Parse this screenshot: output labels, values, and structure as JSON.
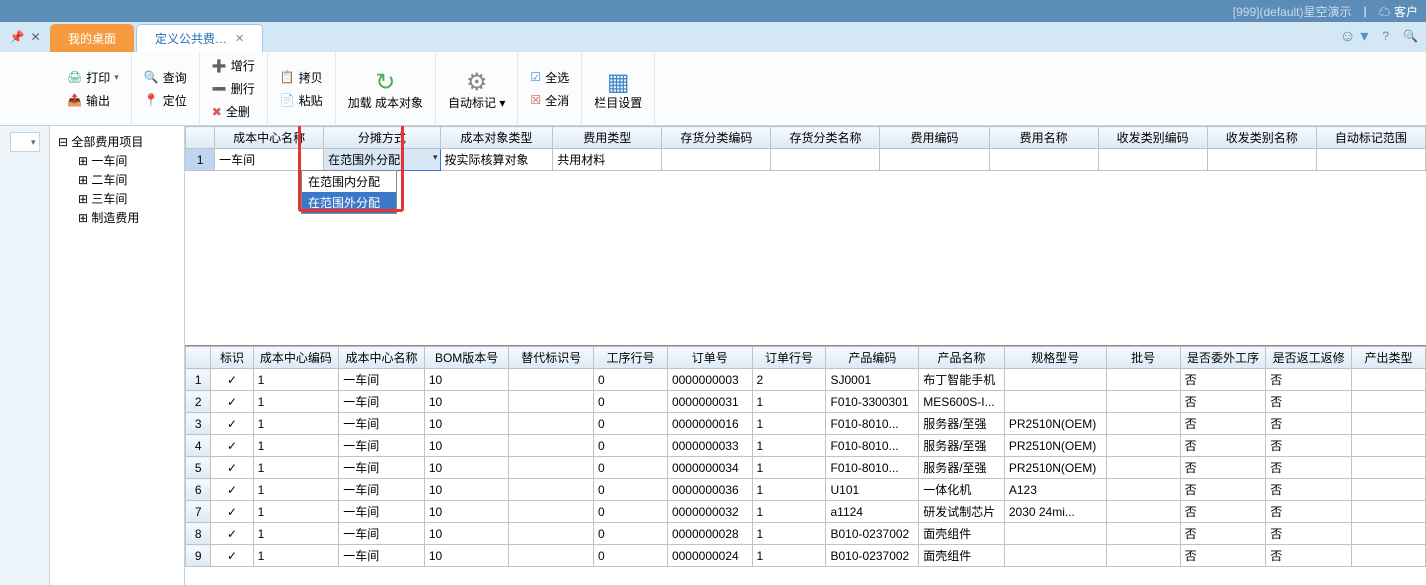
{
  "titlebar": {
    "system": "[999](default)星空演示",
    "cust": "客户"
  },
  "tabs": {
    "t1": "我的桌面",
    "t2": "定义公共费…"
  },
  "toolbar": {
    "print": "打印",
    "output": "输出",
    "search": "查询",
    "locate": "定位",
    "addrow": "增行",
    "delrow": "删行",
    "delall": "全删",
    "copy": "拷贝",
    "paste": "粘贴",
    "load": "加载\n成本对象",
    "autotag": "自动标记",
    "selall": "全选",
    "unselall": "全消",
    "colset": "栏目设置"
  },
  "tree": {
    "root": "全部费用项目",
    "items": [
      "一车间",
      "二车间",
      "三车间",
      "制造费用"
    ]
  },
  "upperTable": {
    "headers": [
      "成本中心名称",
      "分摊方式",
      "成本对象类型",
      "费用类型",
      "存货分类编码",
      "存货分类名称",
      "费用编码",
      "费用名称",
      "收发类别编码",
      "收发类别名称",
      "自动标记范围"
    ],
    "row": {
      "num": "1",
      "center": "一车间",
      "mode": "在范围外分配",
      "objtype": "按实际核算对象",
      "feetype": "共用材料"
    }
  },
  "dropdown": {
    "opt1": "在范围内分配",
    "opt2": "在范围外分配"
  },
  "lowerTable": {
    "headers": [
      "标识",
      "成本中心编码",
      "成本中心名称",
      "BOM版本号",
      "替代标识号",
      "工序行号",
      "订单号",
      "订单行号",
      "产品编码",
      "产品名称",
      "规格型号",
      "批号",
      "是否委外工序",
      "是否返工返修",
      "产出类型"
    ],
    "rows": [
      {
        "n": "1",
        "cc": "1",
        "name": "一车间",
        "bom": "10",
        "sub": "",
        "op": "0",
        "ord": "0000000003",
        "ol": "2",
        "pc": "SJ0001",
        "pn": "布丁智能手机",
        "spec": "",
        "lot": "",
        "wo": "否",
        "rw": "否"
      },
      {
        "n": "2",
        "cc": "1",
        "name": "一车间",
        "bom": "10",
        "sub": "",
        "op": "0",
        "ord": "0000000031",
        "ol": "1",
        "pc": "F010-3300301",
        "pn": "MES600S-I...",
        "spec": "",
        "lot": "",
        "wo": "否",
        "rw": "否"
      },
      {
        "n": "3",
        "cc": "1",
        "name": "一车间",
        "bom": "10",
        "sub": "",
        "op": "0",
        "ord": "0000000016",
        "ol": "1",
        "pc": "F010-8010...",
        "pn": "服务器/至强",
        "spec": "PR2510N(OEM)",
        "lot": "",
        "wo": "否",
        "rw": "否"
      },
      {
        "n": "4",
        "cc": "1",
        "name": "一车间",
        "bom": "10",
        "sub": "",
        "op": "0",
        "ord": "0000000033",
        "ol": "1",
        "pc": "F010-8010...",
        "pn": "服务器/至强",
        "spec": "PR2510N(OEM)",
        "lot": "",
        "wo": "否",
        "rw": "否"
      },
      {
        "n": "5",
        "cc": "1",
        "name": "一车间",
        "bom": "10",
        "sub": "",
        "op": "0",
        "ord": "0000000034",
        "ol": "1",
        "pc": "F010-8010...",
        "pn": "服务器/至强",
        "spec": "PR2510N(OEM)",
        "lot": "",
        "wo": "否",
        "rw": "否"
      },
      {
        "n": "6",
        "cc": "1",
        "name": "一车间",
        "bom": "10",
        "sub": "",
        "op": "0",
        "ord": "0000000036",
        "ol": "1",
        "pc": "U101",
        "pn": "一体化机",
        "spec": "A123",
        "lot": "",
        "wo": "否",
        "rw": "否"
      },
      {
        "n": "7",
        "cc": "1",
        "name": "一车间",
        "bom": "10",
        "sub": "",
        "op": "0",
        "ord": "0000000032",
        "ol": "1",
        "pc": "a1124",
        "pn": "研发试制芯片",
        "spec": "2030 24mi...",
        "lot": "",
        "wo": "否",
        "rw": "否"
      },
      {
        "n": "8",
        "cc": "1",
        "name": "一车间",
        "bom": "10",
        "sub": "",
        "op": "0",
        "ord": "0000000028",
        "ol": "1",
        "pc": "B010-0237002",
        "pn": "面壳组件",
        "spec": "",
        "lot": "",
        "wo": "否",
        "rw": "否"
      },
      {
        "n": "9",
        "cc": "1",
        "name": "一车间",
        "bom": "10",
        "sub": "",
        "op": "0",
        "ord": "0000000024",
        "ol": "1",
        "pc": "B010-0237002",
        "pn": "面壳组件",
        "spec": "",
        "lot": "",
        "wo": "否",
        "rw": "否"
      }
    ]
  }
}
